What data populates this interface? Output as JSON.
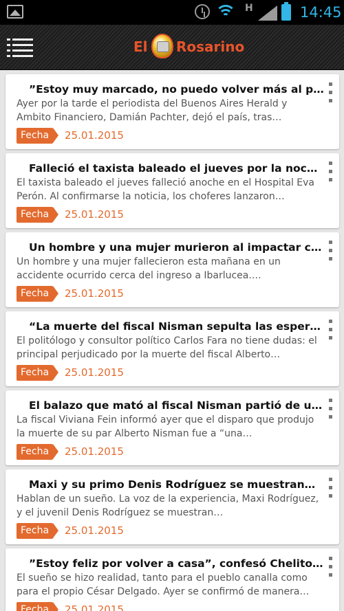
{
  "status_bar": {
    "network_label": "H",
    "time": "14:45",
    "accent": "#33b5e5"
  },
  "app_bar": {
    "logo_left": "El",
    "logo_right": "Rosarino",
    "brand_color": "#e8542a"
  },
  "date_badge_label": "Fecha",
  "articles": [
    {
      "title": "”Estoy muy marcado, no puedo volver más al país,…",
      "excerpt": "Ayer por la tarde el periodista del Buenos Aires Herald y Ambito Financiero, Damián Pachter, dejó el país, tras…",
      "date": "25.01.2015"
    },
    {
      "title": "Falleció el taxista baleado el jueves por la noche en…",
      "excerpt": "El taxista baleado el jueves falleció anoche en el Hospital Eva Perón. Al confirmarse la noticia, los choferes lanzaron…",
      "date": "25.01.2015"
    },
    {
      "title": "Un hombre y una mujer murieron al impactar contra…",
      "excerpt": "Un hombre y una mujer fallecieron esta mañana en un accidente ocurrido cerca del ingreso a Ibarlucea.…",
      "date": "25.01.2015"
    },
    {
      "title": "“La muerte del fiscal Nisman sepulta las esperanzas",
      "excerpt": "El politólogo y consultor político Carlos Fara no tiene dudas: el principal perjudicado por la muerte del fiscal Alberto…",
      "date": "25.01.2015"
    },
    {
      "title": "El balazo que mató al fiscal Nisman partió de un…",
      "excerpt": "La fiscal Viviana Fein informó ayer que el disparo que produjo la muerte de su par Alberto Nisman fue a “una…",
      "date": "25.01.2015"
    },
    {
      "title": "Maxi y su primo Denis Rodríguez se muestran…",
      "excerpt": "Hablan de un sueño. La voz de la experiencia, Maxi Rodríguez, y el juvenil Denis Rodríguez se muestran…",
      "date": "25.01.2015"
    },
    {
      "title": "”Estoy feliz por volver a casa”, confesó Chelito…",
      "excerpt": "El sueño se hizo realidad, tanto para el pueblo canalla como para el propio César Delgado. Ayer se confirmó de manera…",
      "date": "25.01.2015"
    }
  ]
}
